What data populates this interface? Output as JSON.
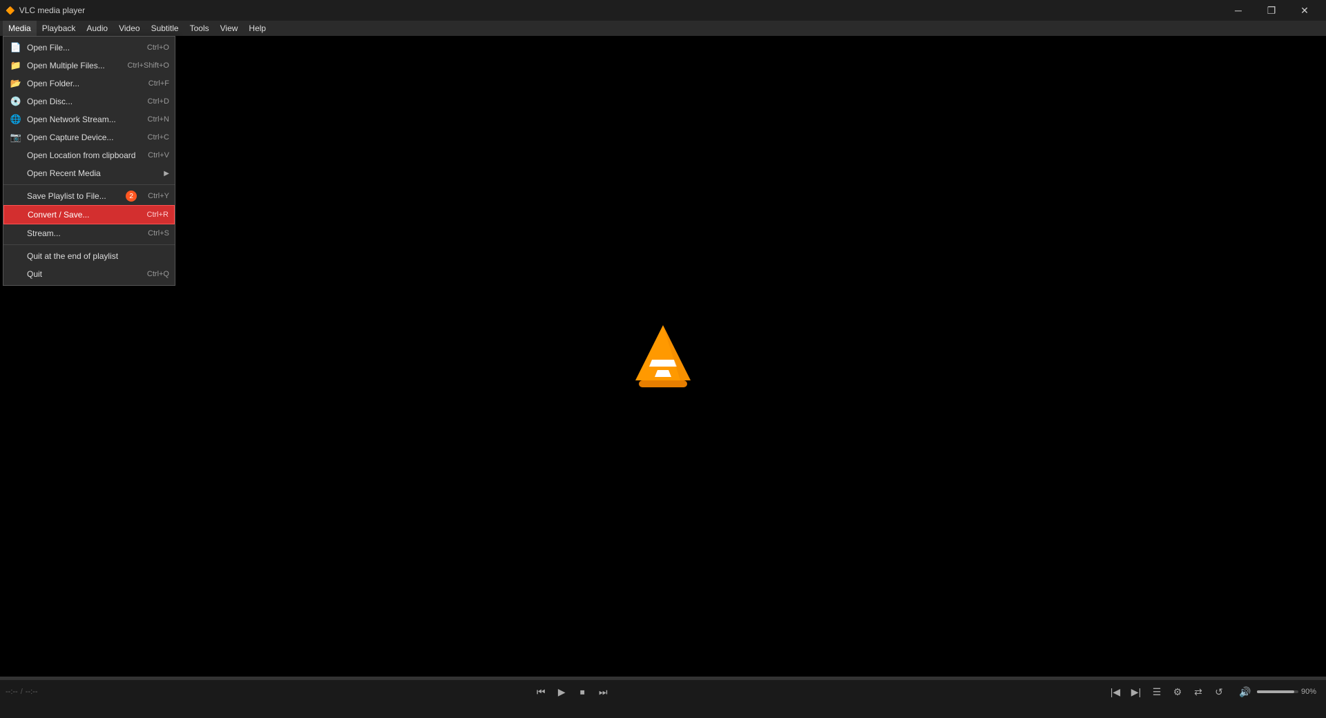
{
  "titlebar": {
    "title": "VLC media player",
    "minimize_label": "─",
    "restore_label": "❐",
    "close_label": "✕"
  },
  "menubar": {
    "items": [
      {
        "id": "media",
        "label": "Media",
        "active": true
      },
      {
        "id": "playback",
        "label": "Playback"
      },
      {
        "id": "audio",
        "label": "Audio"
      },
      {
        "id": "video",
        "label": "Video"
      },
      {
        "id": "subtitle",
        "label": "Subtitle"
      },
      {
        "id": "tools",
        "label": "Tools"
      },
      {
        "id": "view",
        "label": "View"
      },
      {
        "id": "help",
        "label": "Help"
      }
    ]
  },
  "media_menu": {
    "items": [
      {
        "id": "open-file",
        "label": "Open File...",
        "shortcut": "Ctrl+O",
        "icon": "📄",
        "separator_after": false
      },
      {
        "id": "open-multiple",
        "label": "Open Multiple Files...",
        "shortcut": "Ctrl+Shift+O",
        "icon": "📁",
        "separator_after": false
      },
      {
        "id": "open-folder",
        "label": "Open Folder...",
        "shortcut": "Ctrl+F",
        "icon": "📂",
        "separator_after": false
      },
      {
        "id": "open-disc",
        "label": "Open Disc...",
        "shortcut": "Ctrl+D",
        "icon": "💿",
        "separator_after": false
      },
      {
        "id": "open-network",
        "label": "Open Network Stream...",
        "shortcut": "Ctrl+N",
        "icon": "🌐",
        "separator_after": false
      },
      {
        "id": "open-capture",
        "label": "Open Capture Device...",
        "shortcut": "Ctrl+C",
        "icon": "📷",
        "separator_after": false
      },
      {
        "id": "open-location",
        "label": "Open Location from clipboard",
        "shortcut": "Ctrl+V",
        "icon": "",
        "separator_after": false
      },
      {
        "id": "open-recent",
        "label": "Open Recent Media",
        "shortcut": "",
        "icon": "",
        "has_submenu": true,
        "separator_after": true
      },
      {
        "id": "save-playlist",
        "label": "Save Playlist to File...",
        "shortcut": "Ctrl+Y",
        "icon": "",
        "badge": "2",
        "separator_after": false
      },
      {
        "id": "convert-save",
        "label": "Convert / Save...",
        "shortcut": "Ctrl+R",
        "icon": "",
        "highlighted": true,
        "separator_after": false
      },
      {
        "id": "stream",
        "label": "Stream...",
        "shortcut": "Ctrl+S",
        "icon": "",
        "separator_after": true
      },
      {
        "id": "quit-end",
        "label": "Quit at the end of playlist",
        "shortcut": "",
        "icon": "",
        "separator_after": false
      },
      {
        "id": "quit",
        "label": "Quit",
        "shortcut": "Ctrl+Q",
        "icon": "",
        "separator_after": false
      }
    ]
  },
  "controls": {
    "time_current": "--:--",
    "time_total": "--:--",
    "volume_pct": "90%",
    "buttons": [
      {
        "id": "play",
        "icon": "▶",
        "label": "Play"
      },
      {
        "id": "prev",
        "icon": "⏮",
        "label": "Previous"
      },
      {
        "id": "stop",
        "icon": "⏹",
        "label": "Stop"
      },
      {
        "id": "next",
        "icon": "⏭",
        "label": "Next"
      },
      {
        "id": "frame-prev",
        "icon": "◀|",
        "label": "Frame Back"
      },
      {
        "id": "frame-next",
        "icon": "|▶",
        "label": "Frame Forward"
      },
      {
        "id": "playlist",
        "icon": "☰",
        "label": "Playlist"
      },
      {
        "id": "extended",
        "icon": "⚙",
        "label": "Extended Settings"
      },
      {
        "id": "shuffle",
        "icon": "🔀",
        "label": "Shuffle"
      },
      {
        "id": "repeat",
        "icon": "🔁",
        "label": "Repeat"
      }
    ]
  }
}
